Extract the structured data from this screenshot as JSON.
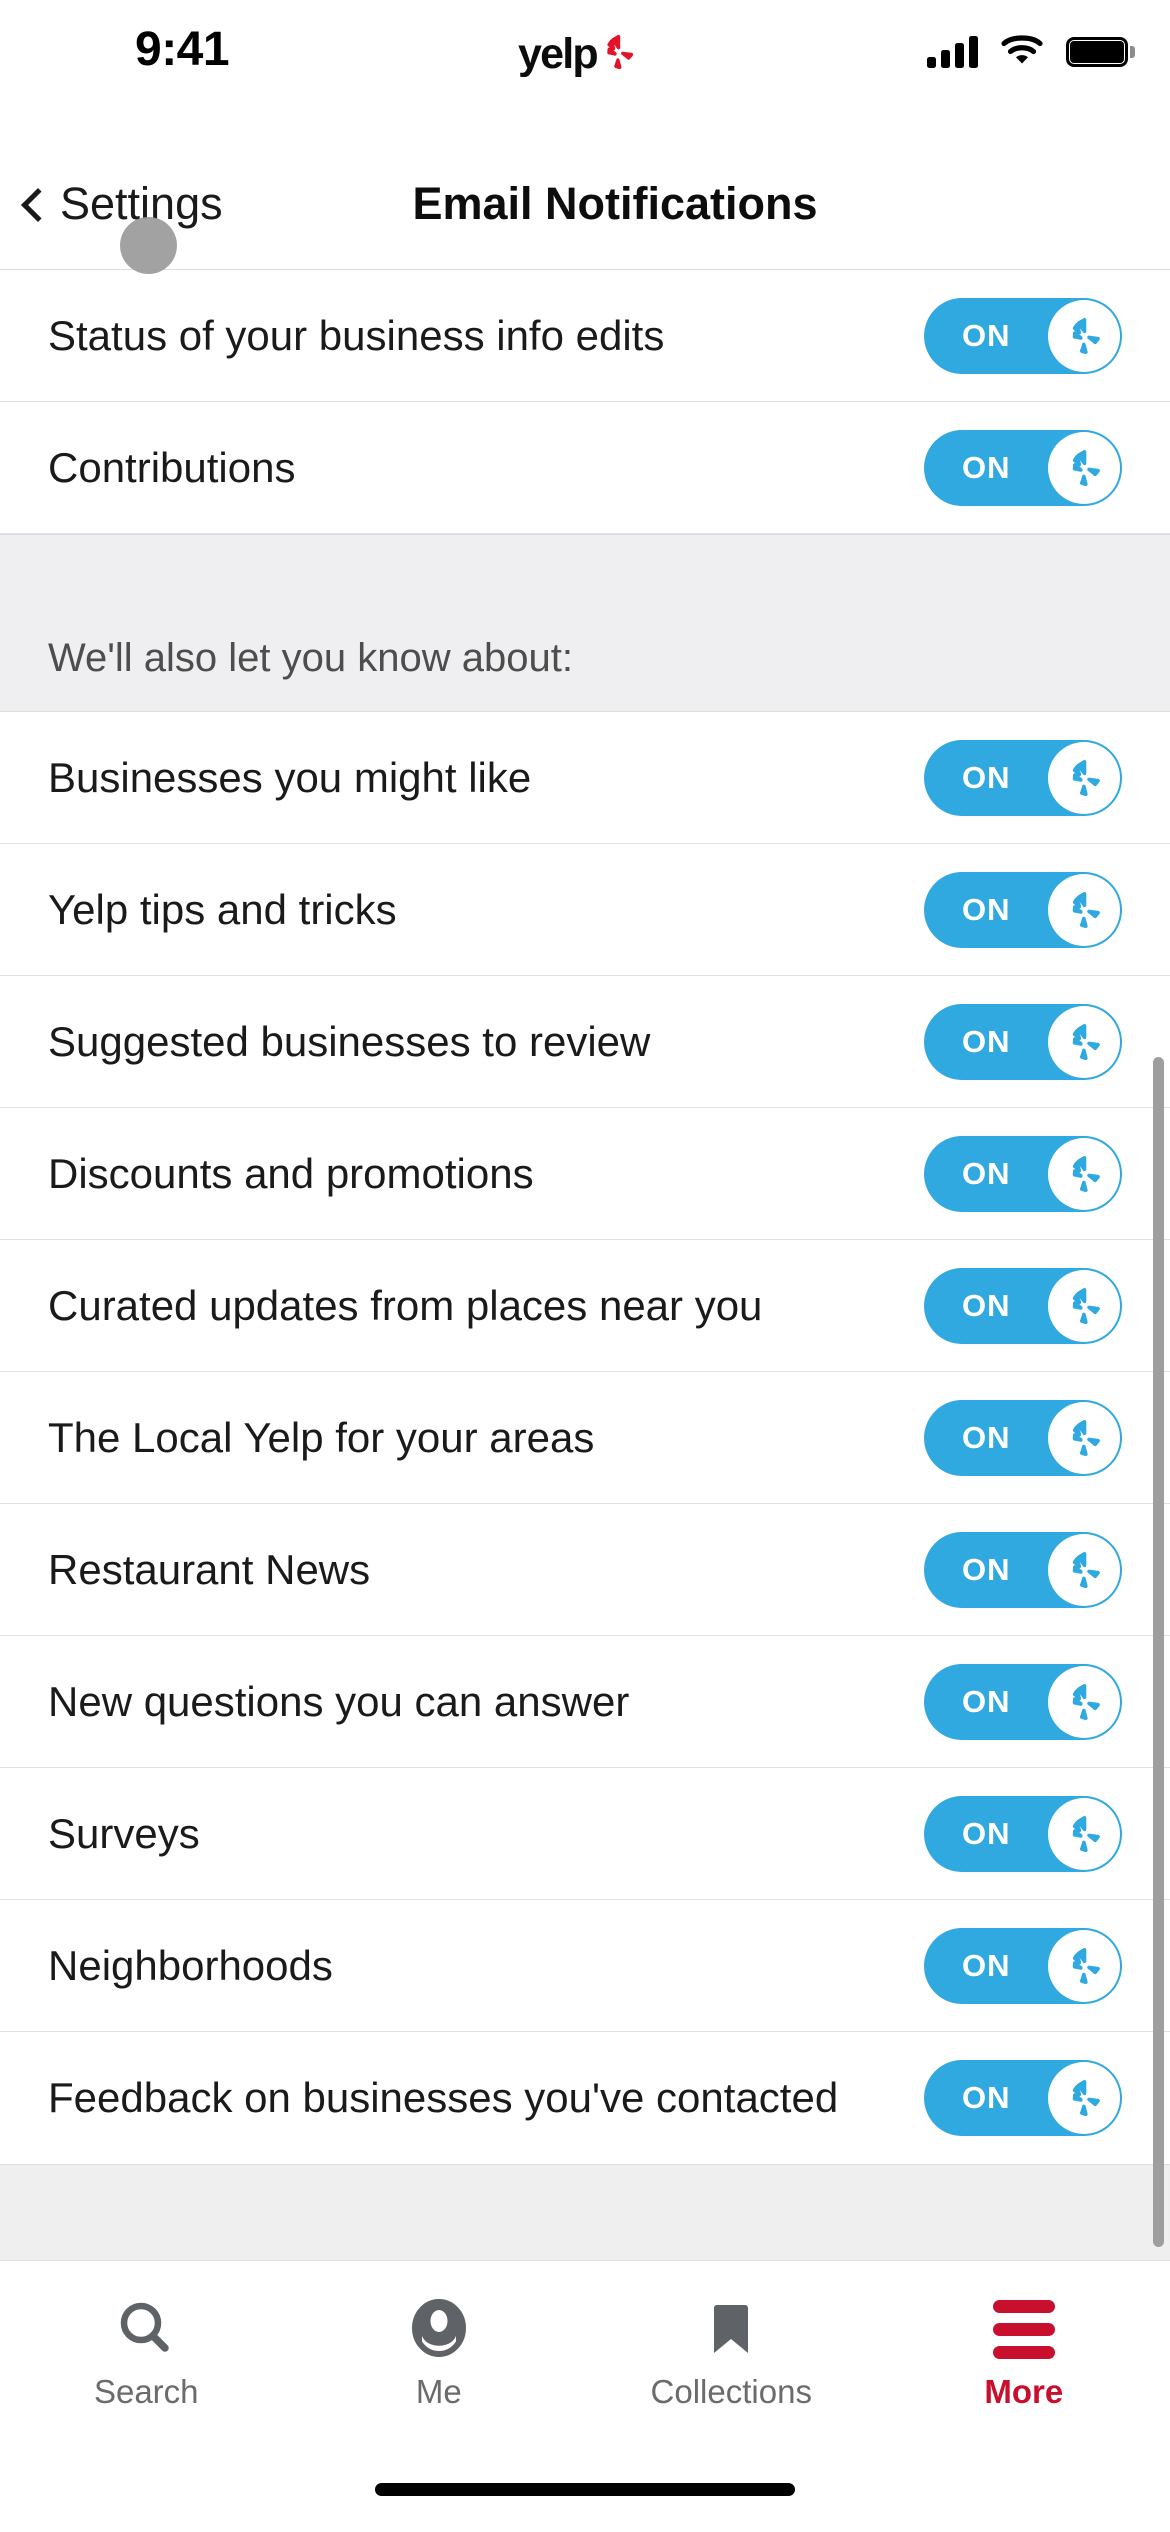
{
  "status_bar": {
    "time": "9:41",
    "brand_wordmark": "yelp",
    "brand_icon": "yelp-burst-icon",
    "signal_icon": "cellular-signal-icon",
    "wifi_icon": "wifi-icon",
    "battery_icon": "battery-full-icon"
  },
  "header": {
    "back_label": "Settings",
    "back_icon": "chevron-left-icon",
    "title": "Email Notifications"
  },
  "section_header": {
    "text": "We'll also let you know about:"
  },
  "toggle": {
    "on_label": "ON",
    "knob_icon": "yelp-burst-icon",
    "track_color": "#30a8e0",
    "knob_color": "#ffffff"
  },
  "top_rows": [
    {
      "label": "Status of your business info edits",
      "state": "ON"
    },
    {
      "label": "Contributions",
      "state": "ON"
    }
  ],
  "rows": [
    {
      "label": "Businesses you might like",
      "state": "ON"
    },
    {
      "label": "Yelp tips and tricks",
      "state": "ON"
    },
    {
      "label": "Suggested businesses to review",
      "state": "ON"
    },
    {
      "label": "Discounts and promotions",
      "state": "ON"
    },
    {
      "label": "Curated updates from places near you",
      "state": "ON"
    },
    {
      "label": "The Local Yelp for your areas",
      "state": "ON"
    },
    {
      "label": "Restaurant News",
      "state": "ON"
    },
    {
      "label": "New questions you can answer",
      "state": "ON"
    },
    {
      "label": "Surveys",
      "state": "ON"
    },
    {
      "label": "Neighborhoods",
      "state": "ON"
    },
    {
      "label": "Feedback on businesses you've contacted",
      "state": "ON"
    }
  ],
  "tab_bar": {
    "items": [
      {
        "label": "Search",
        "icon": "search-icon",
        "active": false
      },
      {
        "label": "Me",
        "icon": "person-icon",
        "active": false
      },
      {
        "label": "Collections",
        "icon": "bookmark-icon",
        "active": false
      },
      {
        "label": "More",
        "icon": "hamburger-menu-icon",
        "active": true
      }
    ],
    "active_color": "#c8102e",
    "inactive_color": "#6b6b6b"
  }
}
